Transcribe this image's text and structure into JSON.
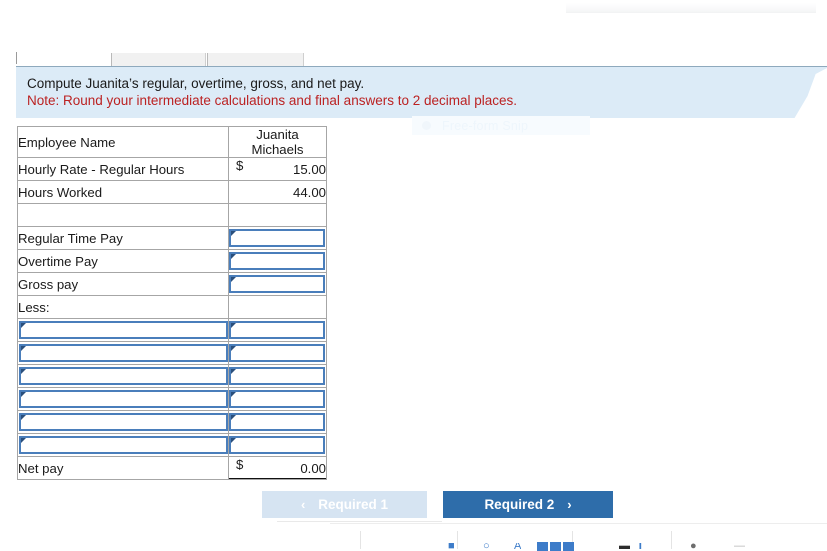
{
  "banner": {
    "line1": "Compute Juanita’s regular, overtime, gross, and net pay.",
    "line2": "Note: Round your intermediate calculations and final answers to 2 decimal places.",
    "background": "#dcebf7",
    "note_color": "#bb2222"
  },
  "ghost_overlay": {
    "label": "Free-form Snip"
  },
  "worksheet": {
    "rows": [
      {
        "label": "Employee Name",
        "value_line1": "Juanita",
        "value_line2": "Michaels",
        "kind": "name"
      },
      {
        "label": "Hourly Rate - Regular Hours",
        "currency": "$",
        "value": "15.00",
        "kind": "money"
      },
      {
        "label": "Hours Worked",
        "value": "44.00",
        "kind": "number"
      },
      {
        "label": "",
        "value": "",
        "kind": "blank"
      },
      {
        "label": "Regular Time Pay",
        "value": "",
        "kind": "label-input"
      },
      {
        "label": "Overtime Pay",
        "value": "",
        "kind": "label-input"
      },
      {
        "label": "Gross pay",
        "value": "",
        "kind": "label-input-total"
      },
      {
        "label": "Less:",
        "value": "",
        "kind": "subheading"
      },
      {
        "label": "",
        "value": "",
        "kind": "input-input"
      },
      {
        "label": "",
        "value": "",
        "kind": "input-input"
      },
      {
        "label": "",
        "value": "",
        "kind": "input-input"
      },
      {
        "label": "",
        "value": "",
        "kind": "input-input"
      },
      {
        "label": "",
        "value": "",
        "kind": "input-input"
      },
      {
        "label": "",
        "value": "",
        "kind": "input-input"
      },
      {
        "label": "Net pay",
        "currency": "$",
        "value": "0.00",
        "kind": "net"
      }
    ]
  },
  "navigation": {
    "prev_label": "Required 1",
    "prev_chevron": "‹",
    "prev_enabled": false,
    "prev_color": "#d6e4f2",
    "next_label": "Required 2",
    "next_chevron": "›",
    "next_enabled": true,
    "next_color": "#2e6daa"
  },
  "bottom_strip": {
    "glyphs": [
      "≡",
      "↺",
      "A",
      "■",
      "❙",
      "●",
      "—"
    ]
  }
}
